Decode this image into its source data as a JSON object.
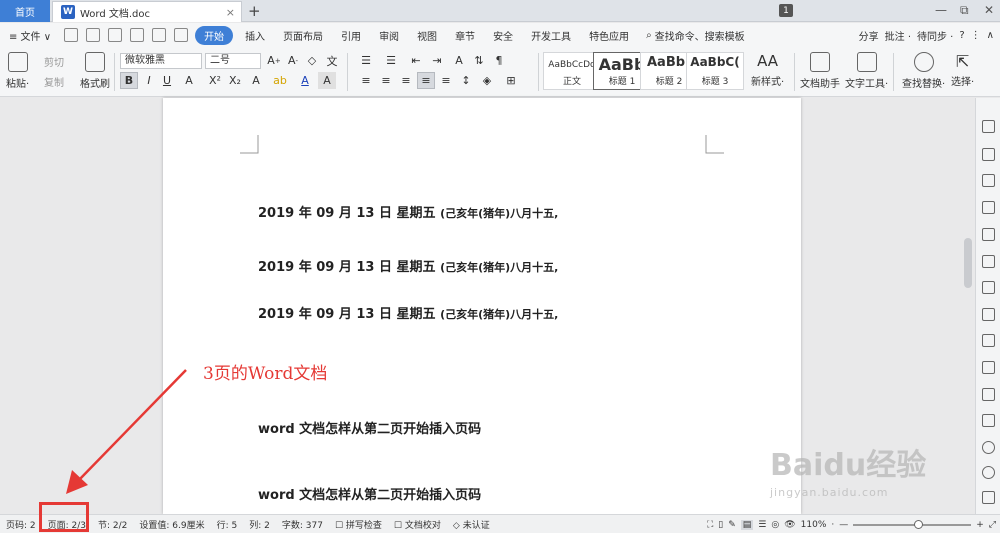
{
  "titlebar": {
    "home_tab": "首页",
    "doc_tab": "Word 文档.doc",
    "logo_letter": "W",
    "close": "×",
    "add": "+",
    "window_badge": "1",
    "min": "—",
    "restore": "⧉",
    "win_close": "✕"
  },
  "menubar": {
    "file": "≡ 文件 ∨",
    "items": [
      "开始",
      "插入",
      "页面布局",
      "引用",
      "审阅",
      "视图",
      "章节",
      "安全",
      "开发工具",
      "特色应用"
    ],
    "search": "查找命令、搜索模板",
    "right": [
      "分享",
      "批注 ·",
      "待同步 ·",
      "?",
      "⋮",
      "∧"
    ]
  },
  "ribbon": {
    "paste": "粘贴·",
    "cut": "剪切",
    "copy": "复制",
    "format_painter": "格式刷",
    "font_name": "微软雅黑",
    "font_size": "二号",
    "styles": [
      {
        "preview": "AaBbCcDd",
        "label": "正文"
      },
      {
        "preview": "AaBb",
        "label": "标题 1"
      },
      {
        "preview": "AaBb(",
        "label": "标题 2"
      },
      {
        "preview": "AaBbC(",
        "label": "标题 3"
      }
    ],
    "new_style": "新样式·",
    "doc_helper": "文档助手",
    "text_tools": "文字工具·",
    "find_replace": "查找替换·",
    "select": "选择·"
  },
  "document": {
    "lines": [
      {
        "main": "2019 年 09 月 13 日  星期五",
        "small": "(己亥年(猪年)八月十五,"
      },
      {
        "main": "2019 年 09 月 13 日  星期五",
        "small": "(己亥年(猪年)八月十五,"
      },
      {
        "main": "2019 年 09 月 13 日  星期五",
        "small": "(己亥年(猪年)八月十五,"
      },
      {
        "main": "word 文档怎样从第二页开始插入页码",
        "small": ""
      },
      {
        "main": "word 文档怎样从第二页开始插入页码",
        "small": ""
      }
    ]
  },
  "annotation": {
    "text": "3页的Word文档",
    "color": "#e53935"
  },
  "statusbar": {
    "page_num": "页码: 2",
    "pages": "页面: 2/3",
    "section": "节: 2/2",
    "setting": "设置值: 6.9厘米",
    "row": "行: 5",
    "col": "列: 2",
    "word_count": "字数: 377",
    "spell_check": "拼写检查",
    "doc_check": "文档校对",
    "uncertified": "未认证",
    "zoom": "110%",
    "zoom_level": 0.55
  },
  "watermark": {
    "big": "Baidu经验",
    "small": "jingyan.baidu.com"
  },
  "colors": {
    "accent": "#3e7fd6"
  }
}
